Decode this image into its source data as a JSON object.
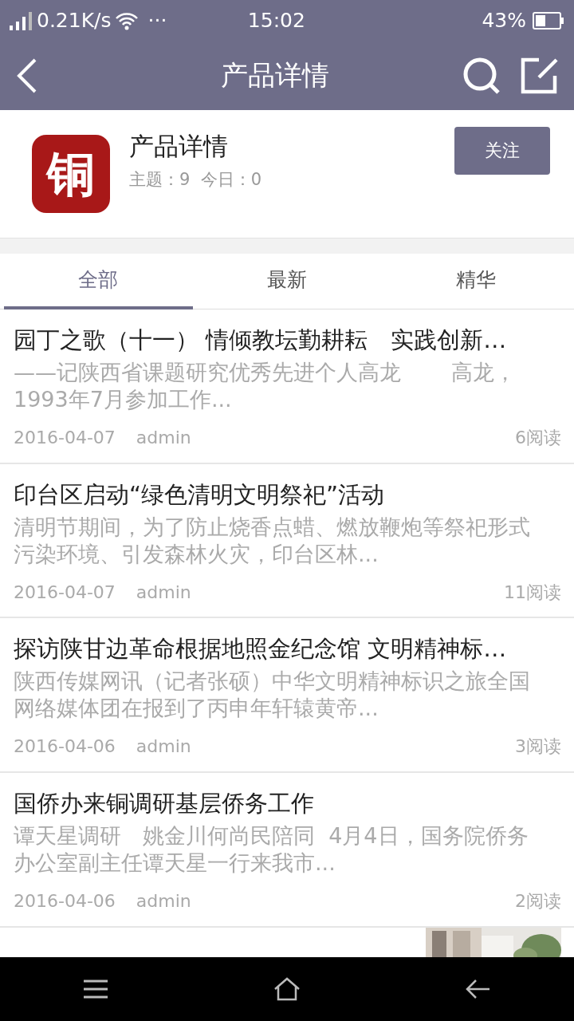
{
  "status_bar": {
    "speed": "0.21K/s",
    "more": "···",
    "time": "15:02",
    "battery": "43%"
  },
  "header": {
    "title": "产品详情"
  },
  "forum": {
    "logo_text": "铜",
    "name": "产品详情",
    "stats": "主题：9  今日：0",
    "follow_button": "关注"
  },
  "tabs": [
    {
      "label": "全部",
      "selected": true
    },
    {
      "label": "最新",
      "selected": false
    },
    {
      "label": "精华",
      "selected": false
    }
  ],
  "posts": [
    {
      "title": "园丁之歌（十一） 情倾教坛勤耕耘　实践创新…",
      "summary": "——记陕西省课题研究优秀先进个人高龙　　 高龙，1993年7月参加工作...",
      "date": "2016-04-07",
      "author": "admin",
      "reads": "6阅读"
    },
    {
      "title": "印台区启动“绿色清明文明祭祀”活动",
      "summary": "清明节期间，为了防止烧香点蜡、燃放鞭炮等祭祀形式污染环境、引发森林火灾，印台区林...",
      "date": "2016-04-07",
      "author": "admin",
      "reads": "11阅读"
    },
    {
      "title": "探访陕甘边革命根据地照金纪念馆 文明精神标…",
      "summary": "陕西传媒网讯（记者张硕）中华文明精神标识之旅全国网络媒体团在报到了丙申年轩辕黄帝...",
      "date": "2016-04-06",
      "author": "admin",
      "reads": "3阅读"
    },
    {
      "title": "国侨办来铜调研基层侨务工作",
      "summary": "谭天星调研　姚金川何尚民陪同  4月4日，国务院侨务办公室副主任谭天星一行来我市...",
      "date": "2016-04-06",
      "author": "admin",
      "reads": "2阅读"
    },
    {
      "kind": "picture"
    }
  ]
}
